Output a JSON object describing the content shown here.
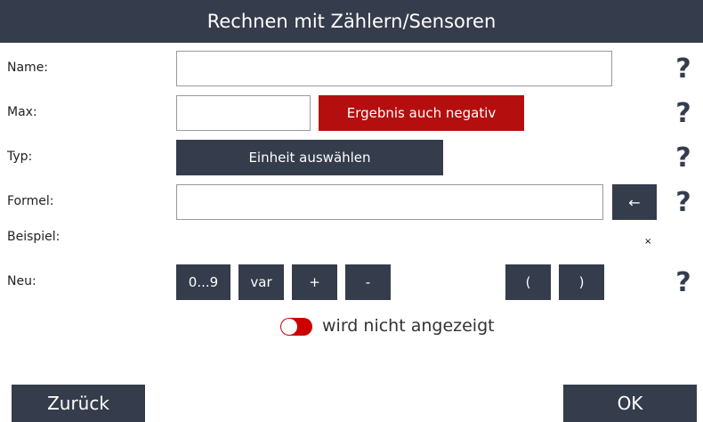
{
  "header": {
    "title": "Rechnen mit Zählern/Sensoren"
  },
  "labels": {
    "name": "Name:",
    "max": "Max:",
    "typ": "Typ:",
    "formel": "Formel:",
    "beispiel": "Beispiel:",
    "neu": "Neu:"
  },
  "fields": {
    "name": {
      "value": ""
    },
    "max": {
      "value": ""
    },
    "formel": {
      "value": ""
    }
  },
  "buttons": {
    "negative": "Ergebnis auch negativ",
    "unit": "Einheit auswählen",
    "backspace": "←",
    "digits": "0...9",
    "var": "var",
    "plus": "+",
    "minus": "-",
    "paren_open": "(",
    "paren_close": ")",
    "back": "Zurück",
    "ok": "OK"
  },
  "help": "?",
  "close_small": "×",
  "toggle": {
    "label": "wird nicht angezeigt",
    "on": false
  },
  "colors": {
    "primary": "#353c4b",
    "accent_red": "#b50e0e"
  },
  "icons": [
    "question-icon",
    "backspace-arrow-icon",
    "close-icon",
    "toggle-switch"
  ]
}
